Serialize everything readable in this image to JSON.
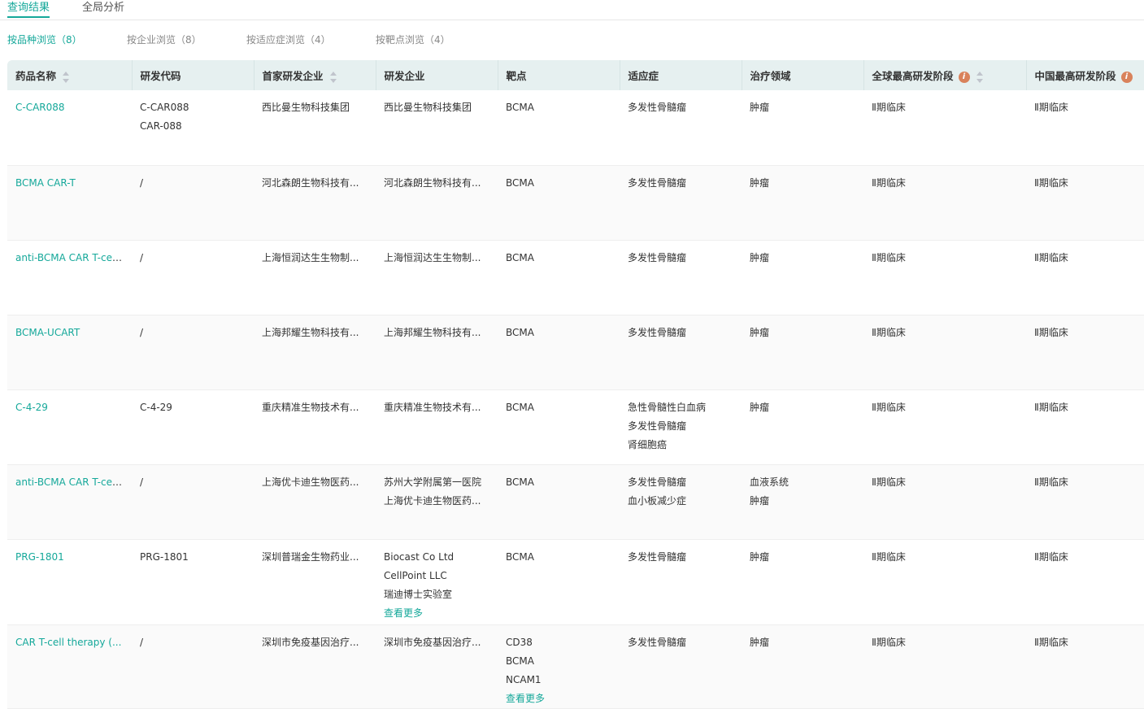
{
  "tabs": [
    {
      "label": "查询结果",
      "active": true
    },
    {
      "label": "全局分析",
      "active": false
    }
  ],
  "subtabs": [
    {
      "label": "按品种浏览（8）"
    },
    {
      "label": "按企业浏览（8）"
    },
    {
      "label": "按适应症浏览（4）"
    },
    {
      "label": "按靶点浏览（4）"
    }
  ],
  "columns": [
    "药品名称",
    "研发代码",
    "首家研发企业",
    "研发企业",
    "靶点",
    "适应症",
    "治疗领域",
    "全球最高研发阶段",
    "中国最高研发阶段"
  ],
  "accent": "#15a89a",
  "more_label": "查看更多",
  "rows": [
    {
      "name": "C-CAR088",
      "code": [
        "C-CAR088",
        "CAR-088"
      ],
      "first": "西比曼生物科技集团",
      "dev": [
        "西比曼生物科技集团"
      ],
      "target": [
        "BCMA"
      ],
      "ind": [
        "多发性骨髓瘤"
      ],
      "area": [
        "肿瘤"
      ],
      "global": "Ⅱ期临床",
      "china": "Ⅱ期临床"
    },
    {
      "name": "BCMA CAR-T",
      "code": [
        "/"
      ],
      "first": "河北森朗生物科技有...",
      "dev": [
        "河北森朗生物科技有..."
      ],
      "target": [
        "BCMA"
      ],
      "ind": [
        "多发性骨髓瘤"
      ],
      "area": [
        "肿瘤"
      ],
      "global": "Ⅱ期临床",
      "china": "Ⅱ期临床"
    },
    {
      "name": "anti-BCMA CAR T-cel...",
      "code": [
        "/"
      ],
      "first": "上海恒润达生生物制...",
      "dev": [
        "上海恒润达生生物制..."
      ],
      "target": [
        "BCMA"
      ],
      "ind": [
        "多发性骨髓瘤"
      ],
      "area": [
        "肿瘤"
      ],
      "global": "Ⅱ期临床",
      "china": "Ⅱ期临床"
    },
    {
      "name": "BCMA-UCART",
      "code": [
        "/"
      ],
      "first": "上海邦耀生物科技有...",
      "dev": [
        "上海邦耀生物科技有..."
      ],
      "target": [
        "BCMA"
      ],
      "ind": [
        "多发性骨髓瘤"
      ],
      "area": [
        "肿瘤"
      ],
      "global": "Ⅱ期临床",
      "china": "Ⅱ期临床"
    },
    {
      "name": "C-4-29",
      "code": [
        "C-4-29"
      ],
      "first": "重庆精准生物技术有...",
      "dev": [
        "重庆精准生物技术有..."
      ],
      "target": [
        "BCMA"
      ],
      "ind": [
        "急性骨髓性白血病",
        "多发性骨髓瘤",
        "肾细胞癌"
      ],
      "area": [
        "肿瘤"
      ],
      "global": "Ⅱ期临床",
      "china": "Ⅱ期临床"
    },
    {
      "name": "anti-BCMA CAR T-cel...",
      "code": [
        "/"
      ],
      "first": "上海优卡迪生物医药...",
      "dev": [
        "苏州大学附属第一医院",
        "上海优卡迪生物医药..."
      ],
      "target": [
        "BCMA"
      ],
      "ind": [
        "多发性骨髓瘤",
        "血小板减少症"
      ],
      "area": [
        "血液系统",
        "肿瘤"
      ],
      "global": "Ⅱ期临床",
      "china": "Ⅱ期临床"
    },
    {
      "name": "PRG-1801",
      "code": [
        "PRG-1801"
      ],
      "first": "深圳普瑞金生物药业...",
      "dev": [
        "Biocast Co Ltd",
        "CellPoint LLC",
        "瑞迪博士实验室"
      ],
      "dev_more": true,
      "target": [
        "BCMA"
      ],
      "ind": [
        "多发性骨髓瘤"
      ],
      "area": [
        "肿瘤"
      ],
      "global": "Ⅱ期临床",
      "china": "Ⅱ期临床"
    },
    {
      "name": "CAR T-cell therapy (...",
      "code": [
        "/"
      ],
      "first": "深圳市免疫基因治疗...",
      "dev": [
        "深圳市免疫基因治疗..."
      ],
      "target": [
        "CD38",
        "BCMA",
        "NCAM1"
      ],
      "target_more": true,
      "ind": [
        "多发性骨髓瘤"
      ],
      "area": [
        "肿瘤"
      ],
      "global": "Ⅱ期临床",
      "china": "Ⅱ期临床"
    }
  ]
}
